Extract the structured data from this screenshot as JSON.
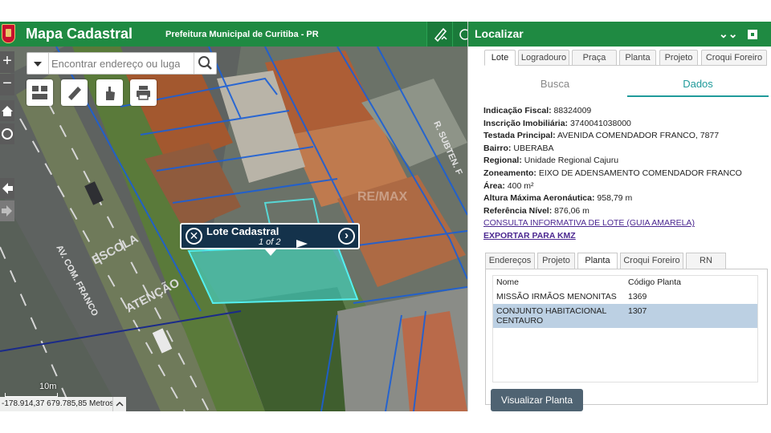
{
  "header": {
    "app_title": "Mapa Cadastral",
    "subtitle": "Prefeitura Municipal de Curitiba - PR"
  },
  "map": {
    "search": {
      "placeholder": "Encontrar endereço ou lugar"
    },
    "zoom_in": "+",
    "zoom_out": "−",
    "scale_label": "10m",
    "coordinates": "-178.914,37 679.785,85 Metros",
    "street_labels": [
      "AV. COM. FRANCO",
      "R. SUBTEN. F",
      "ESCOLA",
      "ATENÇÃO"
    ],
    "watermark": "RE/MAX",
    "popup": {
      "title": "Lote Cadastral",
      "pager": "1 of 2"
    }
  },
  "panel": {
    "title": "Localizar",
    "tabs": [
      "Lote",
      "Logradouro",
      "Praça",
      "Planta",
      "Projeto",
      "Croqui Foreiro"
    ],
    "active_tab": "Lote",
    "segments": [
      "Busca",
      "Dados"
    ],
    "active_segment": "Dados",
    "fields": [
      {
        "label": "Indicação Fiscal:",
        "value": "88324009"
      },
      {
        "label": "Inscrição Imobiliária:",
        "value": "3740041038000"
      },
      {
        "label": "Testada Principal:",
        "value": "AVENIDA COMENDADOR FRANCO, 7877"
      },
      {
        "label": "Bairro:",
        "value": "UBERABA"
      },
      {
        "label": "Regional:",
        "value": "Unidade Regional Cajuru"
      },
      {
        "label": "Zoneamento:",
        "value": "EIXO DE ADENSAMENTO COMENDADOR FRANCO"
      },
      {
        "label": "Área:",
        "value": "400 m²"
      },
      {
        "label": "Altura Máxima Aeronáutica:",
        "value": "958,79 m"
      },
      {
        "label": "Referência Nível:",
        "value": "876,06 m"
      }
    ],
    "links": [
      "CONSULTA INFORMATIVA DE LOTE (GUIA AMARELA)",
      "EXPORTAR PARA KMZ"
    ],
    "subtabs": [
      "Endereços",
      "Projeto",
      "Planta",
      "Croqui Foreiro",
      "RN"
    ],
    "active_subtab": "Planta",
    "table": {
      "columns": [
        "Nome",
        "Código Planta"
      ],
      "rows": [
        {
          "nome": "MISSÃO IRMÃOS MENONITAS",
          "codigo": "1369",
          "selected": false
        },
        {
          "nome": "CONJUNTO HABITACIONAL CENTAURO",
          "codigo": "1307",
          "selected": true
        }
      ]
    },
    "button": "Visualizar Planta"
  },
  "colors": {
    "brand_green": "#1f8a42",
    "accent_teal": "#1f9a9a",
    "link_purple": "#4b2790",
    "parcel_highlight": "#43e3e3",
    "parcel_lines": "#1b5fd6"
  }
}
